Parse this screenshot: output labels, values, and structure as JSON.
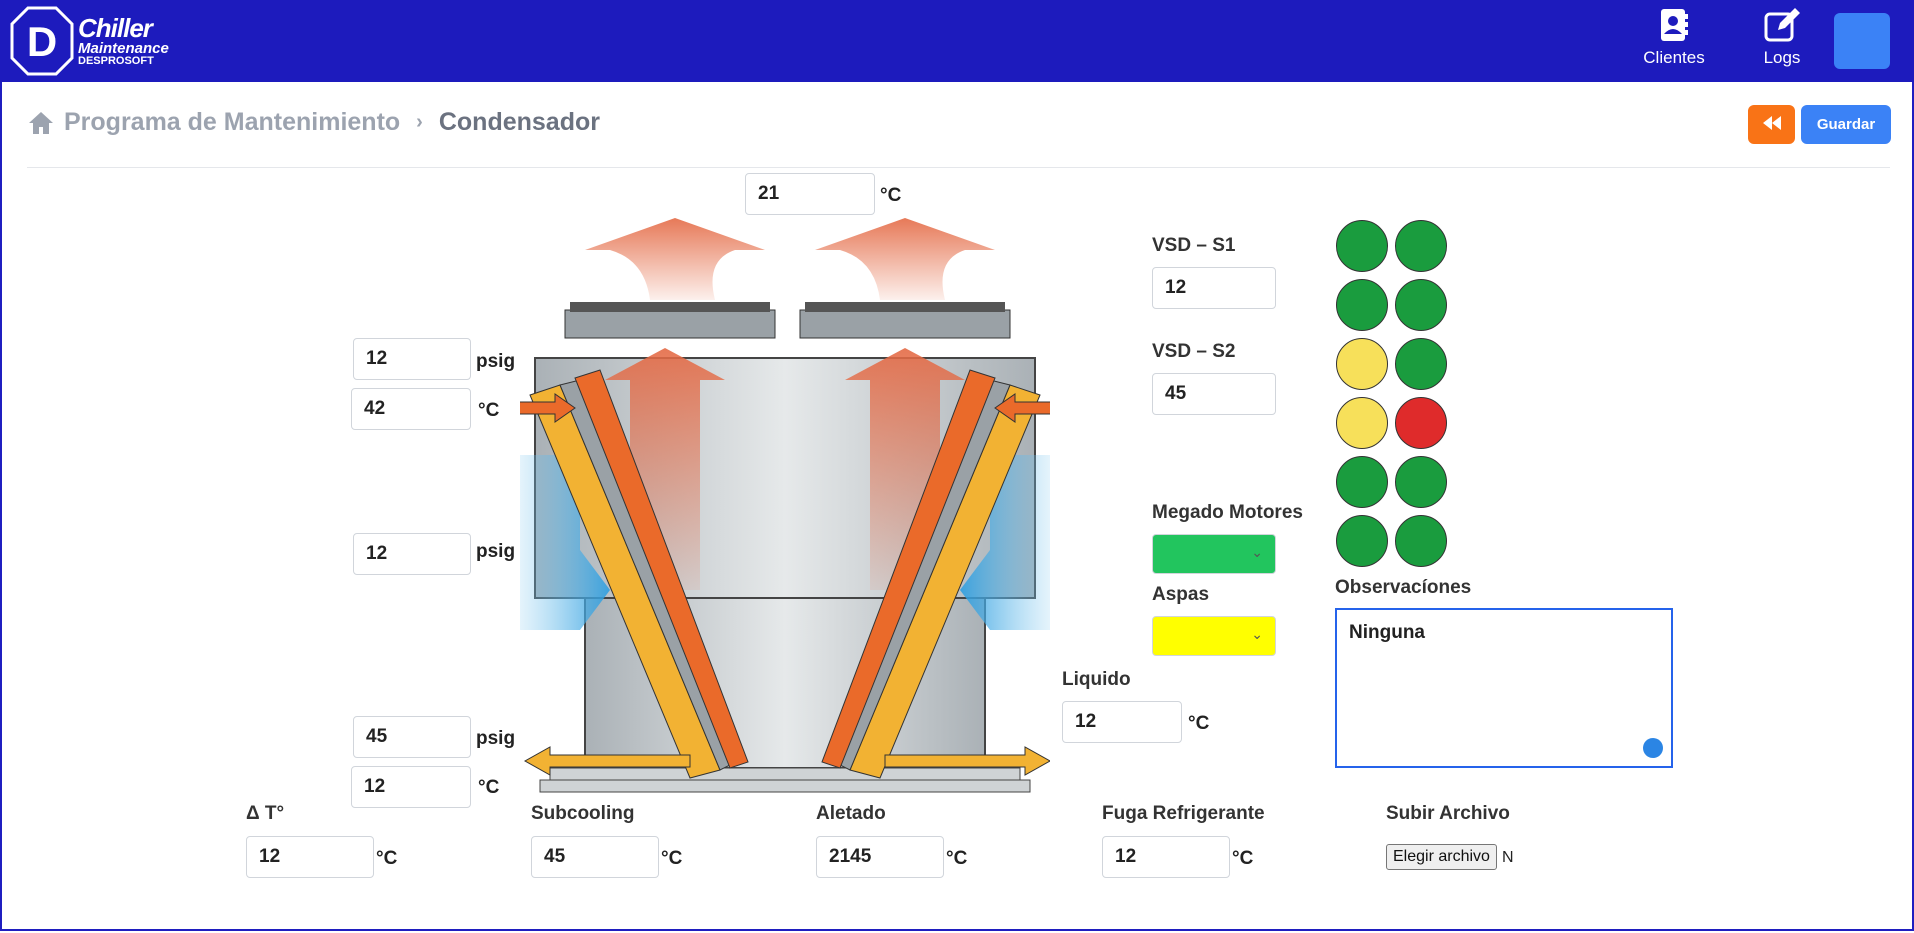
{
  "app": {
    "logo_line1": "Chiller",
    "logo_line2": "Maintenance",
    "logo_line3": "DESPROSOFT",
    "logo_letter": "D"
  },
  "nav": {
    "clientes": "Clientes",
    "logs": "Logs"
  },
  "breadcrumb": {
    "home": "Programa de Mantenimiento",
    "current": "Condensador"
  },
  "actions": {
    "back_icon": "fast-backward-icon",
    "save": "Guardar"
  },
  "diagram": {
    "top_temp": {
      "value": "21",
      "unit": "°C"
    },
    "inlet_pressure": {
      "value": "12",
      "unit": "psig"
    },
    "inlet_temp": {
      "value": "42",
      "unit": "°C"
    },
    "mid_pressure": {
      "value": "12",
      "unit": "psig"
    },
    "outlet_pressure": {
      "value": "45",
      "unit": "psig"
    },
    "outlet_temp": {
      "value": "12",
      "unit": "°C"
    }
  },
  "vsd": {
    "s1_label": "VSD – S1",
    "s1_value": "12",
    "s2_label": "VSD – S2",
    "s2_value": "45"
  },
  "megado": {
    "label": "Megado Motores",
    "color": "#22c55e"
  },
  "aspas": {
    "label": "Aspas",
    "color": "#ffff00"
  },
  "liquido": {
    "label": "Liquido",
    "value": "12",
    "unit": "°C"
  },
  "status_grid": [
    [
      "#1a9c3e",
      "#1a9c3e"
    ],
    [
      "#1a9c3e",
      "#1a9c3e"
    ],
    [
      "#f7e05a",
      "#1a9c3e"
    ],
    [
      "#f7e05a",
      "#df2b2b"
    ],
    [
      "#1a9c3e",
      "#1a9c3e"
    ],
    [
      "#1a9c3e",
      "#1a9c3e"
    ]
  ],
  "observaciones": {
    "label": "Observacíones",
    "value": "Ninguna"
  },
  "bottom": {
    "delta": {
      "label": "Δ T°",
      "value": "12",
      "unit": "°C"
    },
    "subcooling": {
      "label": "Subcooling",
      "value": "45",
      "unit": "°C"
    },
    "aletado": {
      "label": "Aletado",
      "value": "2145",
      "unit": "°C"
    },
    "fuga": {
      "label": "Fuga Refrigerante",
      "value": "12",
      "unit": "°C"
    },
    "archivo": {
      "label": "Subir Archivo",
      "button": "Elegir archivo",
      "none": "N"
    }
  }
}
